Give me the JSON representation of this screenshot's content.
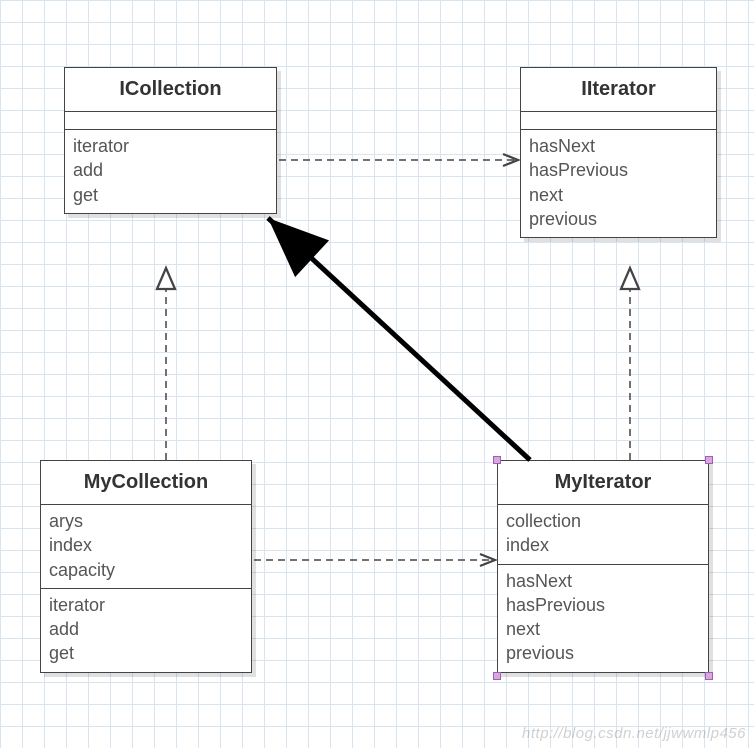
{
  "diagram": {
    "type": "uml-class-diagram",
    "classes": {
      "icollection": {
        "name": "ICollection",
        "attributes": [],
        "methods": [
          "iterator",
          "add",
          "get"
        ]
      },
      "iiterator": {
        "name": "IIterator",
        "attributes": [],
        "methods": [
          "hasNext",
          "hasPrevious",
          "next",
          "previous"
        ]
      },
      "mycollection": {
        "name": "MyCollection",
        "attributes": [
          "arys",
          "index",
          "capacity"
        ],
        "methods": [
          "iterator",
          "add",
          "get"
        ]
      },
      "myiterator": {
        "name": "MyIterator",
        "attributes": [
          "collection",
          "index"
        ],
        "methods": [
          "hasNext",
          "hasPrevious",
          "next",
          "previous"
        ]
      }
    },
    "relationships": [
      {
        "from": "ICollection",
        "to": "IIterator",
        "type": "dependency-dashed-arrow"
      },
      {
        "from": "MyCollection",
        "to": "ICollection",
        "type": "realization-dashed-triangle"
      },
      {
        "from": "MyIterator",
        "to": "IIterator",
        "type": "realization-dashed-triangle"
      },
      {
        "from": "MyCollection",
        "to": "MyIterator",
        "type": "dependency-dashed-arrow"
      },
      {
        "from": "MyIterator",
        "to": "ICollection",
        "type": "association-solid-arrow"
      }
    ]
  },
  "watermark": "http://blog.csdn.net/jjwwmlp456"
}
